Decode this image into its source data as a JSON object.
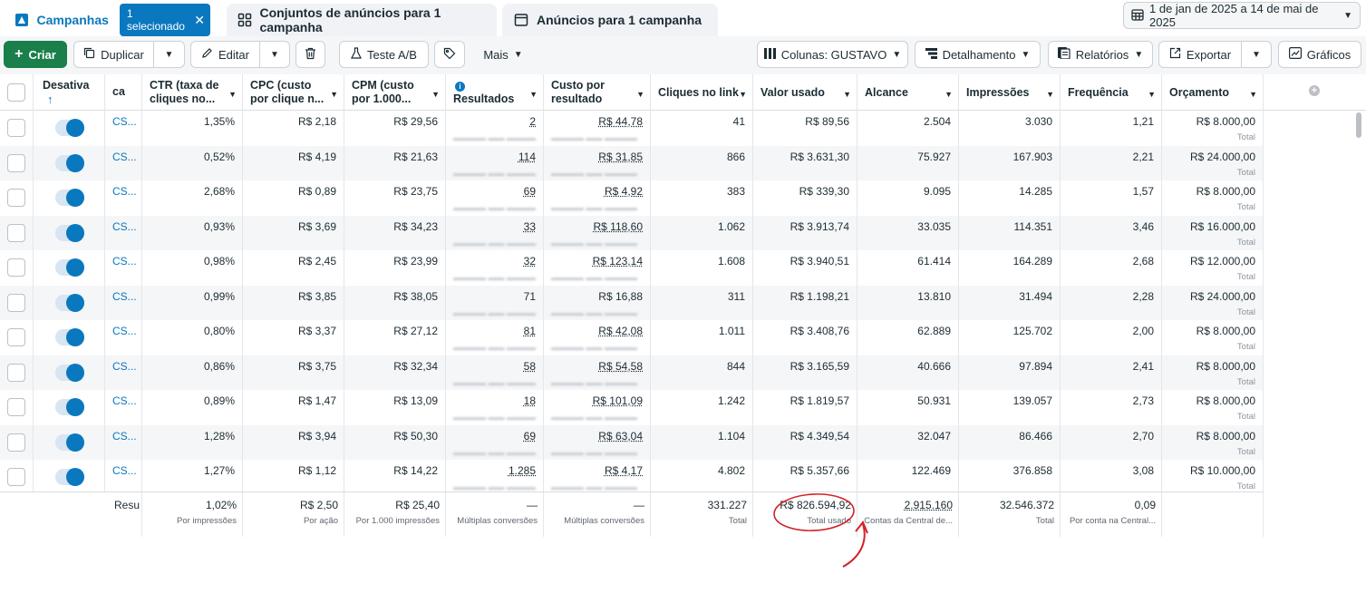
{
  "tabs": {
    "campaigns": "Campanhas",
    "selected_chip": "1 selecionado",
    "adsets": "Conjuntos de anúncios para 1 campanha",
    "ads": "Anúncios para 1 campanha"
  },
  "date_range": "1 de jan de 2025 a 14 de mai de 2025",
  "toolbar": {
    "create": "Criar",
    "duplicate": "Duplicar",
    "edit": "Editar",
    "ab_test": "Teste A/B",
    "more": "Mais",
    "columns": "Colunas: GUSTAVO",
    "breakdown": "Detalhamento",
    "reports": "Relatórios",
    "export": "Exportar",
    "charts": "Gráficos"
  },
  "headers": {
    "toggle": "Desativa",
    "campaign": "ca",
    "ctr": "CTR (taxa de cliques no...",
    "cpc": "CPC (custo por clique n...",
    "cpm": "CPM (custo por 1.000...",
    "results": "Resultados",
    "cost_per_result": "Custo por resultado",
    "link_clicks": "Cliques no link",
    "spent": "Valor usado",
    "reach": "Alcance",
    "impressions": "Impressões",
    "frequency": "Frequência",
    "budget": "Orçamento"
  },
  "rows": [
    {
      "name": "CS...",
      "ctr": "1,35%",
      "cpc": "R$ 2,18",
      "cpm": "R$ 29,56",
      "results": "2",
      "cpr": "R$ 44,78",
      "clicks": "41",
      "spent": "R$ 89,56",
      "reach": "2.504",
      "impressions": "3.030",
      "frequency": "1,21",
      "budget": "R$ 8.000,00",
      "budget_sub": "Total"
    },
    {
      "name": "CS...",
      "ctr": "0,52%",
      "cpc": "R$ 4,19",
      "cpm": "R$ 21,63",
      "results": "114",
      "cpr": "R$ 31,85",
      "clicks": "866",
      "spent": "R$ 3.631,30",
      "reach": "75.927",
      "impressions": "167.903",
      "frequency": "2,21",
      "budget": "R$ 24.000,00",
      "budget_sub": "Total"
    },
    {
      "name": "CS...",
      "ctr": "2,68%",
      "cpc": "R$ 0,89",
      "cpm": "R$ 23,75",
      "results": "69",
      "cpr": "R$ 4,92",
      "clicks": "383",
      "spent": "R$ 339,30",
      "reach": "9.095",
      "impressions": "14.285",
      "frequency": "1,57",
      "budget": "R$ 8.000,00",
      "budget_sub": "Total"
    },
    {
      "name": "CS...",
      "ctr": "0,93%",
      "cpc": "R$ 3,69",
      "cpm": "R$ 34,23",
      "results": "33",
      "cpr": "R$ 118,60",
      "clicks": "1.062",
      "spent": "R$ 3.913,74",
      "reach": "33.035",
      "impressions": "114.351",
      "frequency": "3,46",
      "budget": "R$ 16.000,00",
      "budget_sub": "Total"
    },
    {
      "name": "CS...",
      "ctr": "0,98%",
      "cpc": "R$ 2,45",
      "cpm": "R$ 23,99",
      "results": "32",
      "cpr": "R$ 123,14",
      "clicks": "1.608",
      "spent": "R$ 3.940,51",
      "reach": "61.414",
      "impressions": "164.289",
      "frequency": "2,68",
      "budget": "R$ 12.000,00",
      "budget_sub": "Total"
    },
    {
      "name": "CS...",
      "ctr": "0,99%",
      "cpc": "R$ 3,85",
      "cpm": "R$ 38,05",
      "results": "71",
      "cpr": "R$ 16,88",
      "clicks": "311",
      "spent": "R$ 1.198,21",
      "reach": "13.810",
      "impressions": "31.494",
      "frequency": "2,28",
      "budget": "R$ 24.000,00",
      "budget_sub": "Total"
    },
    {
      "name": "CS...",
      "ctr": "0,80%",
      "cpc": "R$ 3,37",
      "cpm": "R$ 27,12",
      "results": "81",
      "cpr": "R$ 42,08",
      "clicks": "1.011",
      "spent": "R$ 3.408,76",
      "reach": "62.889",
      "impressions": "125.702",
      "frequency": "2,00",
      "budget": "R$ 8.000,00",
      "budget_sub": "Total"
    },
    {
      "name": "CS...",
      "ctr": "0,86%",
      "cpc": "R$ 3,75",
      "cpm": "R$ 32,34",
      "results": "58",
      "cpr": "R$ 54,58",
      "clicks": "844",
      "spent": "R$ 3.165,59",
      "reach": "40.666",
      "impressions": "97.894",
      "frequency": "2,41",
      "budget": "R$ 8.000,00",
      "budget_sub": "Total"
    },
    {
      "name": "CS...",
      "ctr": "0,89%",
      "cpc": "R$ 1,47",
      "cpm": "R$ 13,09",
      "results": "18",
      "cpr": "R$ 101,09",
      "clicks": "1.242",
      "spent": "R$ 1.819,57",
      "reach": "50.931",
      "impressions": "139.057",
      "frequency": "2,73",
      "budget": "R$ 8.000,00",
      "budget_sub": "Total"
    },
    {
      "name": "CS...",
      "ctr": "1,28%",
      "cpc": "R$ 3,94",
      "cpm": "R$ 50,30",
      "results": "69",
      "cpr": "R$ 63,04",
      "clicks": "1.104",
      "spent": "R$ 4.349,54",
      "reach": "32.047",
      "impressions": "86.466",
      "frequency": "2,70",
      "budget": "R$ 8.000,00",
      "budget_sub": "Total"
    },
    {
      "name": "CS...",
      "ctr": "1,27%",
      "cpc": "R$ 1,12",
      "cpm": "R$ 14,22",
      "results": "1.285",
      "cpr": "R$ 4,17",
      "clicks": "4.802",
      "spent": "R$ 5.357,66",
      "reach": "122.469",
      "impressions": "376.858",
      "frequency": "3,08",
      "budget": "R$ 10.000,00",
      "budget_sub": "Total"
    }
  ],
  "footer": {
    "label": "Resu",
    "ctr": "1,02%",
    "ctr_sub": "Por impressões",
    "cpc": "R$ 2,50",
    "cpc_sub": "Por ação",
    "cpm": "R$ 25,40",
    "cpm_sub": "Por 1.000 impressões",
    "results": "—",
    "results_sub": "Múltiplas conversões",
    "cpr": "—",
    "cpr_sub": "Múltiplas conversões",
    "clicks": "331.227",
    "clicks_sub": "Total",
    "spent": "R$ 826.594,92",
    "spent_sub": "Total usado",
    "reach": "2.915.160",
    "reach_sub": "Contas da Central de...",
    "impressions": "32.546.372",
    "impressions_sub": "Total",
    "frequency": "0,09",
    "frequency_sub": "Por conta na Central..."
  },
  "colors": {
    "accent": "#0a78be",
    "create_button": "#1a7f4a",
    "annotation": "#d2232a"
  }
}
